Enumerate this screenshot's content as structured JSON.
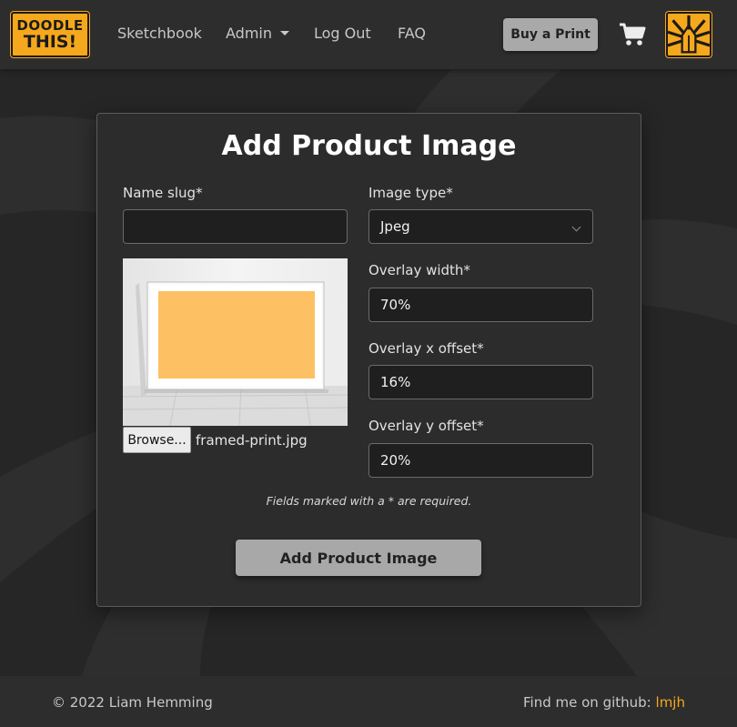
{
  "brand": {
    "logo_line1": "DOODLE",
    "logo_line2": "THIS!",
    "accent_color": "#f6a81c"
  },
  "nav": {
    "items": [
      {
        "label": "Sketchbook"
      },
      {
        "label": "Admin"
      },
      {
        "label": "Log Out"
      },
      {
        "label": "FAQ"
      }
    ],
    "buy_label": "Buy a Print",
    "cart_icon": "shopping-cart-icon",
    "profile_icon": "pencil-sunburst-icon"
  },
  "form": {
    "title": "Add Product Image",
    "name_slug": {
      "label": "Name slug*",
      "value": ""
    },
    "image_type": {
      "label": "Image type*",
      "value": "Jpeg"
    },
    "overlay_width": {
      "label": "Overlay width*",
      "value": "70%"
    },
    "overlay_x_offset": {
      "label": "Overlay x offset*",
      "value": "16%"
    },
    "overlay_y_offset": {
      "label": "Overlay y offset*",
      "value": "20%"
    },
    "file": {
      "browse_label": "Browse...",
      "file_name": "framed-print.jpg"
    },
    "required_note": "Fields marked with a * are required.",
    "submit_label": "Add Product Image"
  },
  "footer": {
    "copyright": "© 2022 Liam Hemming",
    "github_prefix": "Find me on github:",
    "github_user": "lmjh"
  }
}
